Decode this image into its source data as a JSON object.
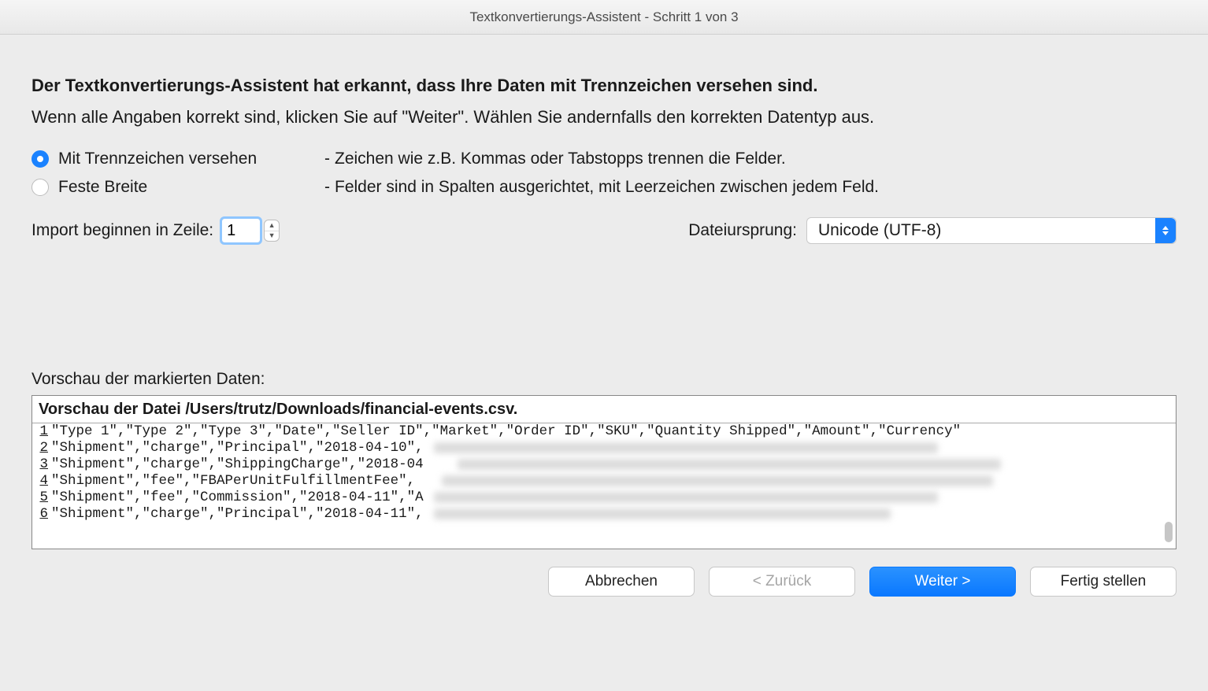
{
  "window": {
    "title": "Textkonvertierungs-Assistent - Schritt 1 von 3"
  },
  "heading": "Der Textkonvertierungs-Assistent hat erkannt, dass Ihre Daten mit Trennzeichen versehen sind.",
  "subheading": "Wenn alle Angaben korrekt sind, klicken Sie auf \"Weiter\". Wählen Sie andernfalls den korrekten Datentyp aus.",
  "radios": {
    "delimited": {
      "label": "Mit Trennzeichen versehen",
      "desc": "Zeichen wie z.B. Kommas oder Tabstopps trennen die Felder."
    },
    "fixed": {
      "label": "Feste Breite",
      "desc": "Felder sind in Spalten ausgerichtet, mit Leerzeichen zwischen jedem Feld."
    }
  },
  "start_row": {
    "label": "Import beginnen in Zeile:",
    "value": "1"
  },
  "origin": {
    "label": "Dateiursprung:",
    "value": "Unicode (UTF-8)"
  },
  "preview": {
    "label": "Vorschau der markierten Daten:",
    "title": "Vorschau der Datei /Users/trutz/Downloads/financial-events.csv.",
    "lines": [
      "\"Type 1\",\"Type 2\",\"Type 3\",\"Date\",\"Seller ID\",\"Market\",\"Order ID\",\"SKU\",\"Quantity Shipped\",\"Amount\",\"Currency\"",
      "\"Shipment\",\"charge\",\"Principal\",\"2018-04-10\",",
      "\"Shipment\",\"charge\",\"ShippingCharge\",\"2018-04",
      "\"Shipment\",\"fee\",\"FBAPerUnitFulfillmentFee\",",
      "\"Shipment\",\"fee\",\"Commission\",\"2018-04-11\",\"A",
      "\"Shipment\",\"charge\",\"Principal\",\"2018-04-11\","
    ]
  },
  "buttons": {
    "cancel": "Abbrechen",
    "back": "< Zurück",
    "next": "Weiter >",
    "finish": "Fertig stellen"
  }
}
